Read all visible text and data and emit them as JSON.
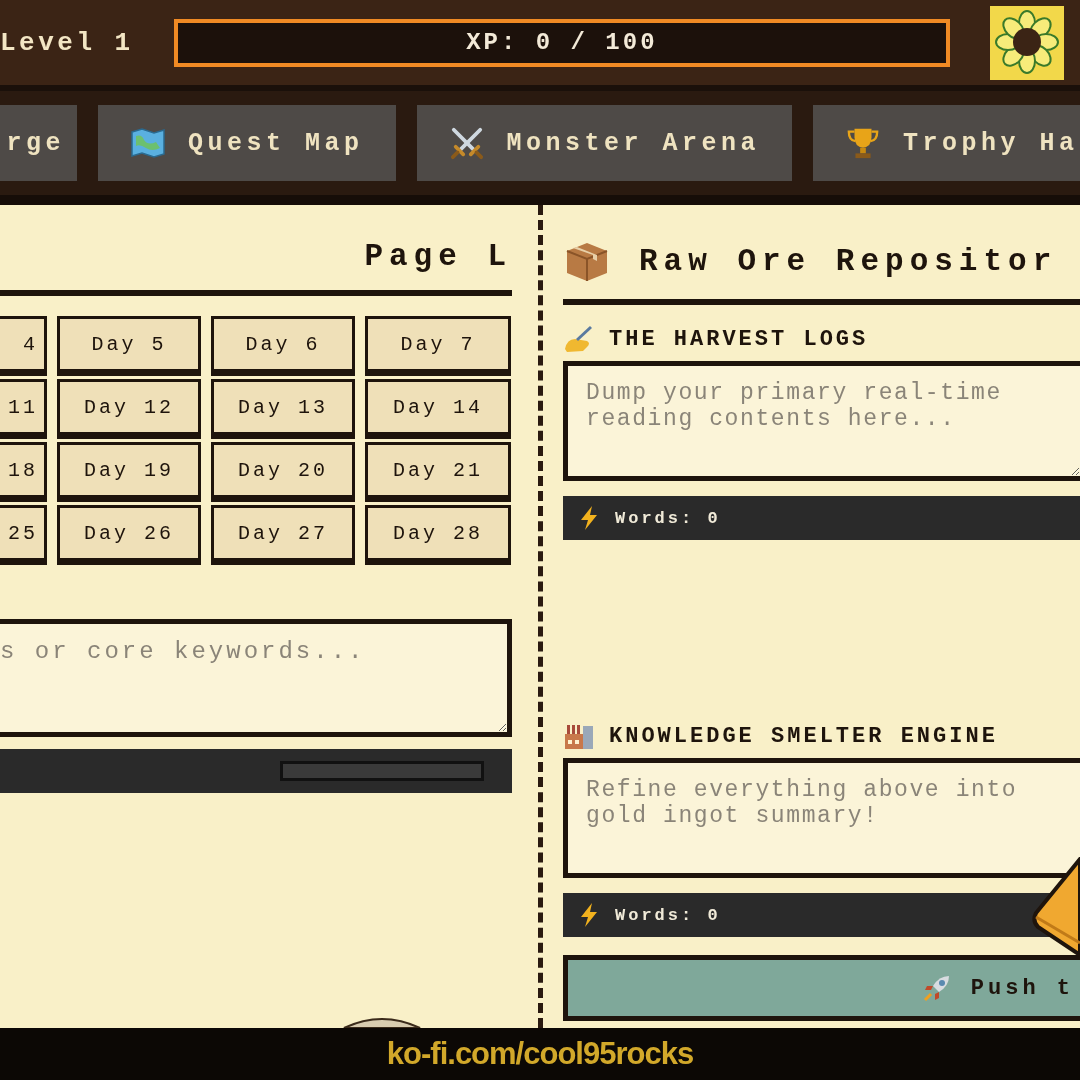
{
  "header": {
    "level_label": "Level 1",
    "xp": {
      "label": "XP: 0 / 100",
      "level": 0
    }
  },
  "tabs": [
    {
      "label": "rge",
      "selected": false
    },
    {
      "label": "Quest Map",
      "selected": false
    },
    {
      "label": "Monster Arena",
      "selected": false
    },
    {
      "label": "Trophy Ha",
      "selected": false
    }
  ],
  "left_panel": {
    "title": "Page L",
    "days": [
      "4",
      "Day 5",
      "Day 6",
      "Day 7",
      "11",
      "Day 12",
      "Day 13",
      "Day 14",
      "18",
      "Day 19",
      "Day 20",
      "Day 21",
      "25",
      "Day 26",
      "Day 27",
      "Day 28"
    ],
    "notes_field": {
      "placeholder": "s or core keywords..."
    },
    "progress": {
      "level": 0
    }
  },
  "right_panel": {
    "title": "Raw Ore Repositor",
    "sections": [
      {
        "heading": "THE HARVEST LOGS",
        "placeholder": "Dump your primary real-time reading contents here...",
        "word_count": "Words: 0"
      },
      {
        "heading": "KNOWLEDGE SMELTER ENGINE",
        "placeholder": "Refine everything above into gold ingot summary!",
        "word_count": "Words: 0"
      }
    ],
    "push_button": "Push t"
  },
  "footer": "ko-fi.com/cool95rocks"
}
